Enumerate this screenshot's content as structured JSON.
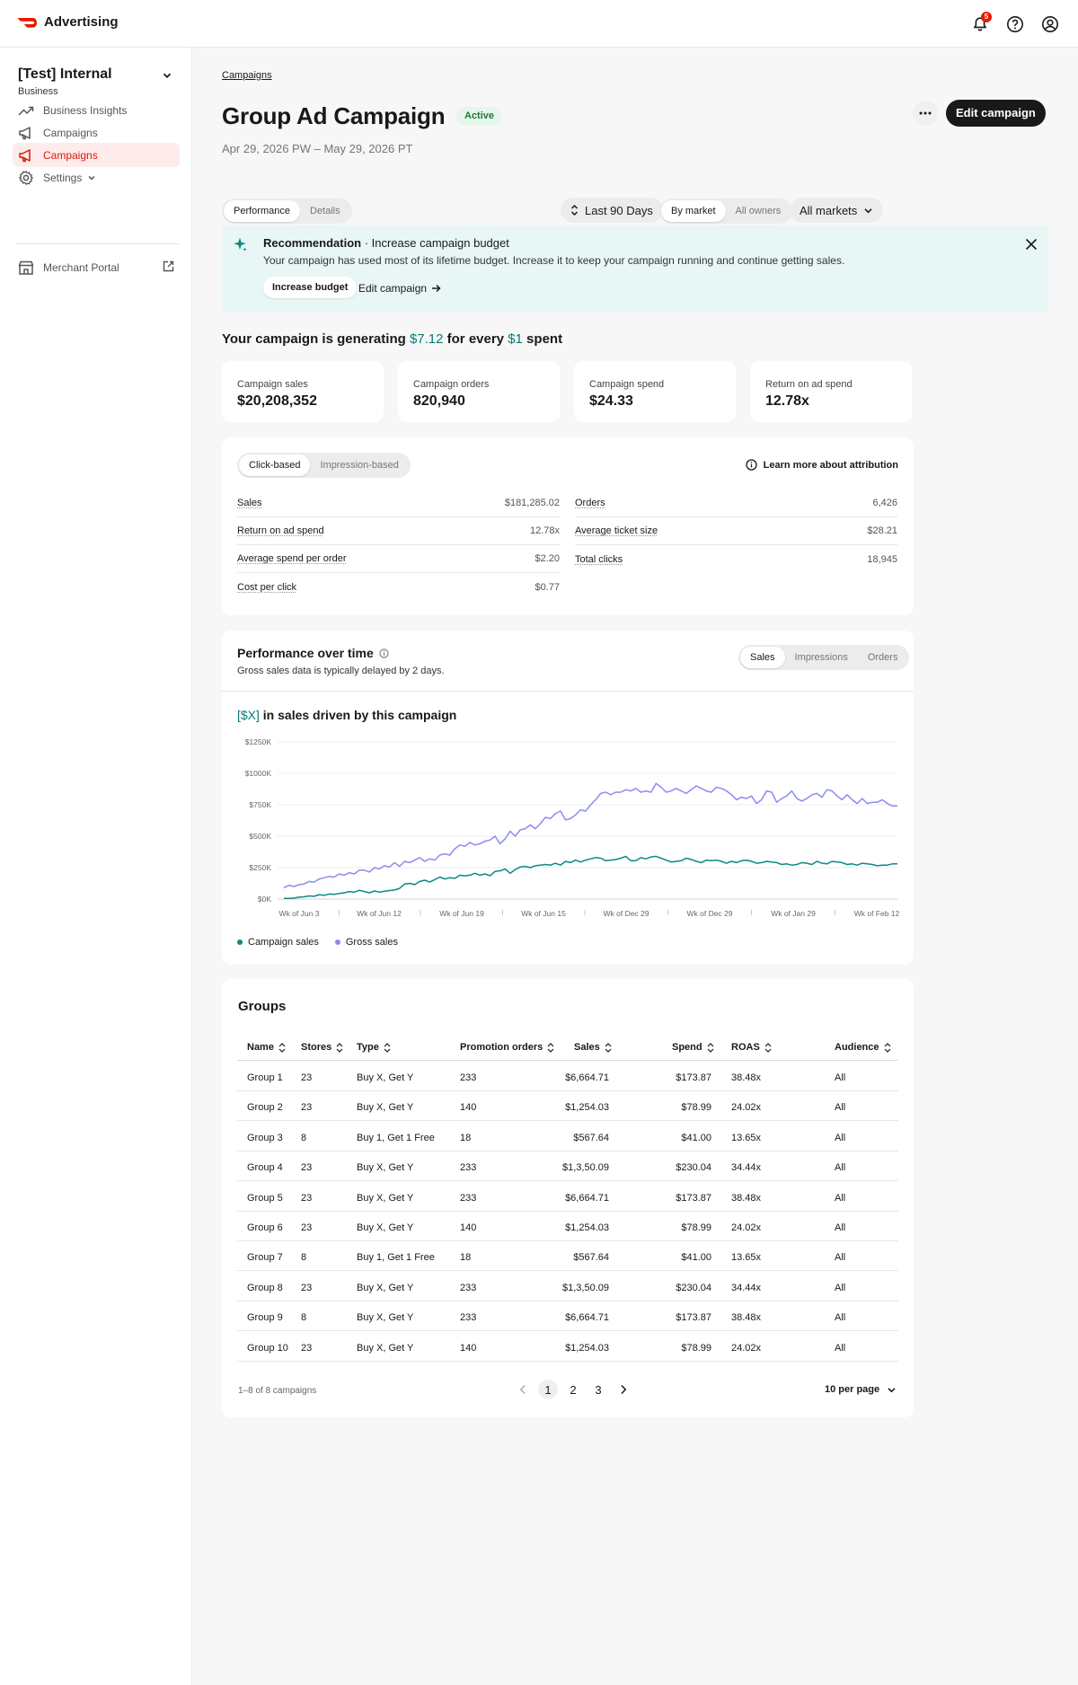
{
  "app": {
    "name": "Advertising",
    "notifications": "5",
    "brand_color": "#eb1700"
  },
  "sidebar": {
    "account_name": "[Test] Internal",
    "account_type": "Business",
    "items": [
      {
        "label": "Business Insights",
        "icon": "trend-icon"
      },
      {
        "label": "Campaigns",
        "icon": "megaphone-icon"
      },
      {
        "label": "Campaigns",
        "icon": "megaphone-icon",
        "active": true
      },
      {
        "label": "Settings",
        "icon": "gear-icon"
      }
    ],
    "merchant_portal": "Merchant Portal"
  },
  "page": {
    "breadcrumb": "Campaigns",
    "title": "Group Ad Campaign",
    "status": "Active",
    "dates": "Apr 29, 2026 PW – May 29, 2026 PT",
    "edit_label": "Edit campaign"
  },
  "tabs": [
    "Performance",
    "Details"
  ],
  "filters": {
    "range": "Last 90 Days",
    "view_options": [
      "By market",
      "All owners"
    ],
    "markets": "All markets"
  },
  "recommendation": {
    "prefix": "Recommendation",
    "title": " · Increase campaign budget",
    "body": "Your campaign has used most of its lifetime budget. Increase it to keep your campaign running and continue getting sales.",
    "primary": "Increase budget",
    "secondary": "Edit campaign"
  },
  "generating": {
    "before": "Your campaign is generating ",
    "amount": "$7.12",
    "middle": " for every ",
    "unit": "$1",
    "after": " spent"
  },
  "kpis": [
    {
      "label": "Campaign sales",
      "value": "$20,208,352"
    },
    {
      "label": "Campaign orders",
      "value": "820,940"
    },
    {
      "label": "Campaign spend",
      "value": "$24.33"
    },
    {
      "label": "Return on ad spend",
      "value": "12.78x"
    }
  ],
  "attribution": {
    "tabs": [
      "Click-based",
      "Impression-based"
    ],
    "learn_more": "Learn more about attribution",
    "left": [
      {
        "label": "Sales",
        "value": "$181,285.02"
      },
      {
        "label": "Return on ad spend",
        "value": "12.78x"
      },
      {
        "label": "Average spend per order",
        "value": "$2.20"
      },
      {
        "label": "Cost per click",
        "value": "$0.77"
      }
    ],
    "right": [
      {
        "label": "Orders",
        "value": "6,426"
      },
      {
        "label": "Average ticket size",
        "value": "$28.21"
      },
      {
        "label": "Total clicks",
        "value": "18,945"
      }
    ]
  },
  "performance": {
    "title": "Performance over time",
    "subtitle": "Gross sales data is typically delayed by 2 days.",
    "tabs": [
      "Sales",
      "Impressions",
      "Orders"
    ],
    "headline_value": "[$X]",
    "headline_text": " in sales driven by this campaign"
  },
  "chart_data": {
    "type": "line",
    "title": "",
    "xlabel": "",
    "ylabel": "",
    "ylim": [
      0,
      1250
    ],
    "y_ticks": [
      "$0K",
      "$250K",
      "$500K",
      "$750K",
      "$1000K",
      "$1250K"
    ],
    "x_ticks": [
      "Wk of Jun 3",
      "Wk of Jun 12",
      "Wk of Jun 19",
      "Wk of Jun 15",
      "Wk of Dec 29",
      "Wk of Dec 29",
      "Wk of Jan 29",
      "Wk of Feb 12"
    ],
    "grid": true,
    "legend_position": "bottom-left",
    "series": [
      {
        "name": "Campaign sales",
        "color": "#0b8a80",
        "values": [
          5,
          5,
          8,
          15,
          18,
          25,
          22,
          35,
          30,
          40,
          38,
          45,
          50,
          60,
          55,
          70,
          60,
          50,
          65,
          55,
          62,
          68,
          72,
          85,
          120,
          125,
          115,
          140,
          150,
          135,
          155,
          175,
          160,
          170,
          165,
          190,
          185,
          190,
          205,
          190,
          200,
          185,
          220,
          225,
          240,
          205,
          235,
          255,
          260,
          250,
          265,
          270,
          275,
          270,
          285,
          270,
          300,
          290,
          310,
          295,
          310,
          320,
          330,
          325,
          305,
          310,
          315,
          325,
          340,
          305,
          305,
          330,
          320,
          335,
          340,
          325,
          310,
          295,
          300,
          305,
          325,
          315,
          300,
          290,
          310,
          305,
          310,
          300,
          285,
          300,
          290,
          305,
          310,
          300,
          285,
          290,
          300,
          295,
          290,
          275,
          280,
          270,
          275,
          290,
          285,
          275,
          300,
          285,
          280,
          300,
          295,
          290,
          275,
          280,
          270,
          285,
          280,
          275,
          265,
          270,
          270,
          280,
          280
        ]
      },
      {
        "name": "Gross sales",
        "color": "#8b8cf0",
        "values": [
          90,
          110,
          100,
          115,
          120,
          140,
          135,
          160,
          170,
          180,
          175,
          200,
          190,
          210,
          200,
          230,
          230,
          215,
          250,
          240,
          265,
          255,
          290,
          260,
          300,
          290,
          310,
          330,
          300,
          320,
          310,
          350,
          360,
          350,
          400,
          430,
          420,
          450,
          430,
          440,
          460,
          470,
          500,
          440,
          480,
          540,
          500,
          550,
          560,
          590,
          560,
          600,
          650,
          640,
          680,
          700,
          630,
          640,
          670,
          710,
          700,
          750,
          790,
          840,
          850,
          830,
          850,
          850,
          870,
          860,
          880,
          850,
          860,
          850,
          920,
          890,
          850,
          860,
          880,
          860,
          840,
          870,
          900,
          880,
          860,
          850,
          890,
          880,
          860,
          830,
          790,
          810,
          800,
          820,
          760,
          790,
          860,
          850,
          770,
          800,
          820,
          860,
          800,
          780,
          800,
          830,
          840,
          810,
          870,
          860,
          820,
          790,
          830,
          790,
          760,
          800,
          760,
          770,
          770,
          790,
          760,
          740,
          740
        ]
      }
    ]
  },
  "groups": {
    "title": "Groups",
    "columns": [
      "Name",
      "Stores",
      "Type",
      "Promotion orders",
      "Sales",
      "Spend",
      "ROAS",
      "Audience"
    ],
    "rows": [
      [
        "Group 1",
        "23",
        "Buy X, Get Y",
        "233",
        "$6,664.71",
        "$173.87",
        "38.48x",
        "All"
      ],
      [
        "Group 2",
        "23",
        "Buy X, Get Y",
        "140",
        "$1,254.03",
        "$78.99",
        "24.02x",
        "All"
      ],
      [
        "Group 3",
        "8",
        "Buy 1, Get 1 Free",
        "18",
        "$567.64",
        "$41.00",
        "13.65x",
        "All"
      ],
      [
        "Group 4",
        "23",
        "Buy X, Get Y",
        "233",
        "$1,3,50.09",
        "$230.04",
        "34.44x",
        "All"
      ],
      [
        "Group 5",
        "23",
        "Buy X, Get Y",
        "233",
        "$6,664.71",
        "$173.87",
        "38.48x",
        "All"
      ],
      [
        "Group 6",
        "23",
        "Buy X, Get Y",
        "140",
        "$1,254.03",
        "$78.99",
        "24.02x",
        "All"
      ],
      [
        "Group 7",
        "8",
        "Buy 1, Get 1 Free",
        "18",
        "$567.64",
        "$41.00",
        "13.65x",
        "All"
      ],
      [
        "Group 8",
        "23",
        "Buy X, Get Y",
        "233",
        "$1,3,50.09",
        "$230.04",
        "34.44x",
        "All"
      ],
      [
        "Group 9",
        "8",
        "Buy X, Get Y",
        "233",
        "$6,664.71",
        "$173.87",
        "38.48x",
        "All"
      ],
      [
        "Group 10",
        "23",
        "Buy X, Get Y",
        "140",
        "$1,254.03",
        "$78.99",
        "24.02x",
        "All"
      ]
    ],
    "count": "1–8 of 8 campaigns",
    "pages": [
      "1",
      "2",
      "3"
    ],
    "per_page": "10 per page"
  }
}
